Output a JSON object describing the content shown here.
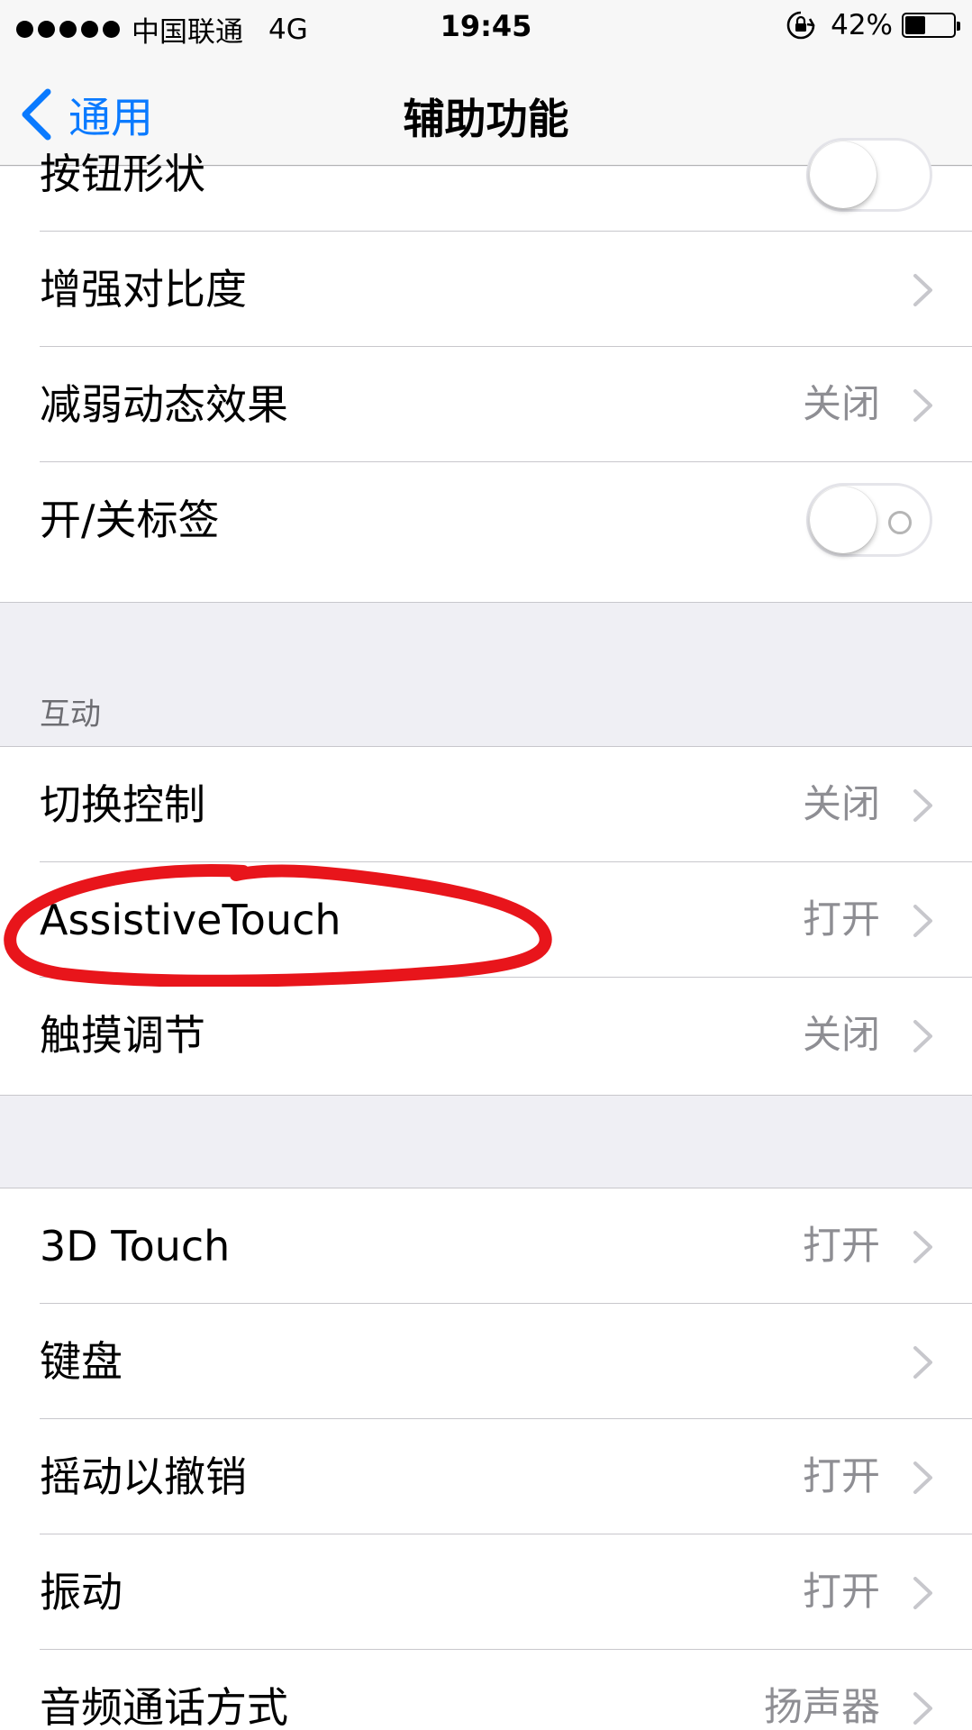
{
  "status_bar": {
    "carrier": "中国联通",
    "network": "4G",
    "time": "19:45",
    "battery_percent": "42%",
    "battery_level": 0.42
  },
  "nav": {
    "back_label": "通用",
    "title": "辅助功能"
  },
  "group1": {
    "button_shapes": {
      "label": "按钮形状",
      "toggle": "off"
    },
    "increase_contrast": {
      "label": "增强对比度"
    },
    "reduce_motion": {
      "label": "减弱动态效果",
      "value": "关闭"
    },
    "on_off_labels": {
      "label": "开/关标签",
      "toggle": "off"
    }
  },
  "section_interaction": {
    "header": "互动"
  },
  "group2": {
    "switch_control": {
      "label": "切换控制",
      "value": "关闭"
    },
    "assistive_touch": {
      "label": "AssistiveTouch",
      "value": "打开"
    },
    "touch_accommodations": {
      "label": "触摸调节",
      "value": "关闭"
    }
  },
  "group3": {
    "touch_3d": {
      "label": "3D Touch",
      "value": "打开"
    },
    "keyboard": {
      "label": "键盘"
    },
    "shake_to_undo": {
      "label": "摇动以撤销",
      "value": "打开"
    },
    "vibration": {
      "label": "振动",
      "value": "打开"
    },
    "call_audio_routing": {
      "label": "音频通话方式",
      "value": "扬声器"
    }
  },
  "colors": {
    "accent": "#0a7aff",
    "annotation": "#e8151b",
    "background": "#efeff4"
  }
}
